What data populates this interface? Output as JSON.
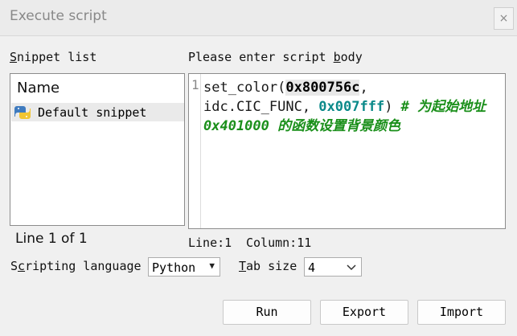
{
  "window": {
    "title": "Execute script",
    "close_label": "×"
  },
  "snippets": {
    "label_key": "S",
    "label_rest": "nippet list",
    "header": "Name",
    "items": [
      {
        "label": "Default snippet",
        "icon": "python-icon"
      }
    ],
    "line_status": "Line 1 of 1"
  },
  "editor": {
    "label_before": "Please enter script ",
    "label_key": "b",
    "label_after": "ody",
    "line_number": "1",
    "code": {
      "t1": "set_color(",
      "t2": "0x800756c",
      "t3": ",",
      "t4": "idc.CIC_FUNC, ",
      "t5": "0x007fff",
      "t6": ")  ",
      "comment": "# 为起始地址 0x401000 的函数设置背景颜色"
    },
    "line_label": "Line:1",
    "column_label": "Column:11"
  },
  "options": {
    "language_label_before": "S",
    "language_label_key": "c",
    "language_label_after": "ripting language",
    "language_value": "Python",
    "tab_label_key": "T",
    "tab_label_rest": "ab size",
    "tab_value": "4"
  },
  "buttons": {
    "run": "Run",
    "export": "Export",
    "import": "Import"
  }
}
